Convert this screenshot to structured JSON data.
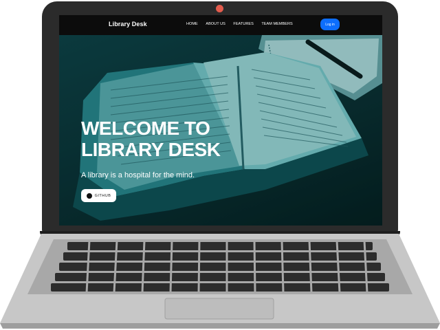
{
  "nav": {
    "brand": "Library Desk",
    "links": [
      "HOME",
      "ABOUT US",
      "FEATURES",
      "TEAM MEMBERS"
    ],
    "login_label": "Log in"
  },
  "hero": {
    "headline_line1": "WELCOME TO",
    "headline_line2": "LIBRARY DESK",
    "tagline": "A library is a hospital for the mind.",
    "github_label": "GITHUB"
  },
  "colors": {
    "nav_bg": "#0c0c0c",
    "login_button": "#0d6efd",
    "hero_tint": "#0d3f44",
    "camera": "#e45c4d"
  },
  "icons": [
    "github-icon",
    "camera-icon"
  ]
}
